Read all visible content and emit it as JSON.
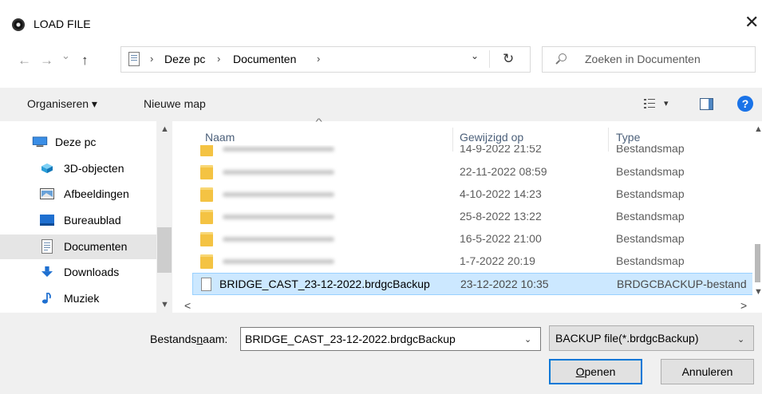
{
  "window": {
    "title": "LOAD FILE",
    "close_glyph": "✕"
  },
  "nav_buttons": {
    "back": "←",
    "forward": "→",
    "recent": "⌄",
    "up": "↑"
  },
  "address": {
    "crumbs": [
      "Deze pc",
      "Documenten"
    ],
    "separator": "›",
    "dropdown_glyph": "⌄",
    "refresh_glyph": "↻"
  },
  "search": {
    "placeholder": "Zoeken in Documenten"
  },
  "toolbar": {
    "organise_label": "Organiseren ▾",
    "new_folder_label": "Nieuwe map",
    "views_dropdown": "▾",
    "help_glyph": "?"
  },
  "nav_pane": {
    "items": [
      {
        "label": "Deze pc",
        "icon": "monitor-icon"
      },
      {
        "label": "3D-objecten",
        "icon": "cube-icon"
      },
      {
        "label": "Afbeeldingen",
        "icon": "pictures-icon"
      },
      {
        "label": "Bureaublad",
        "icon": "desktop-icon"
      },
      {
        "label": "Documenten",
        "icon": "document-icon",
        "selected": true
      },
      {
        "label": "Downloads",
        "icon": "download-icon"
      },
      {
        "label": "Muziek",
        "icon": "music-icon"
      }
    ],
    "scroll_up": "▲",
    "scroll_down": "▼"
  },
  "file_list": {
    "columns": {
      "name": "Naam",
      "modified": "Gewijzigd op",
      "type": "Type"
    },
    "sort_glyph": "^",
    "rows": [
      {
        "date": "14-9-2022 21:52",
        "type": "Bestandsmap"
      },
      {
        "date": "22-11-2022 08:59",
        "type": "Bestandsmap"
      },
      {
        "date": "4-10-2022 14:23",
        "type": "Bestandsmap"
      },
      {
        "date": "25-8-2022 13:22",
        "type": "Bestandsmap"
      },
      {
        "date": "16-5-2022 21:00",
        "type": "Bestandsmap"
      },
      {
        "date": "1-7-2022 20:19",
        "type": "Bestandsmap"
      }
    ],
    "selected_row": {
      "name": "BRIDGE_CAST_23-12-2022.brdgcBackup",
      "date": "23-12-2022 10:35",
      "type": "BRDGCBACKUP-bestand"
    },
    "scroll_left": "<",
    "scroll_right": ">",
    "scroll_up": "▲",
    "scroll_down": "▼"
  },
  "bottom": {
    "filename_label_pre": "Bestands",
    "filename_label_ul": "n",
    "filename_label_post": "aam:",
    "filename_value": "BRIDGE_CAST_23-12-2022.brdgcBackup",
    "filename_dd": "⌄",
    "filter_value": "BACKUP file(*.brdgcBackup)",
    "filter_dd": "⌄",
    "open_ul": "O",
    "open_rest": "penen",
    "cancel_label": "Annuleren"
  }
}
